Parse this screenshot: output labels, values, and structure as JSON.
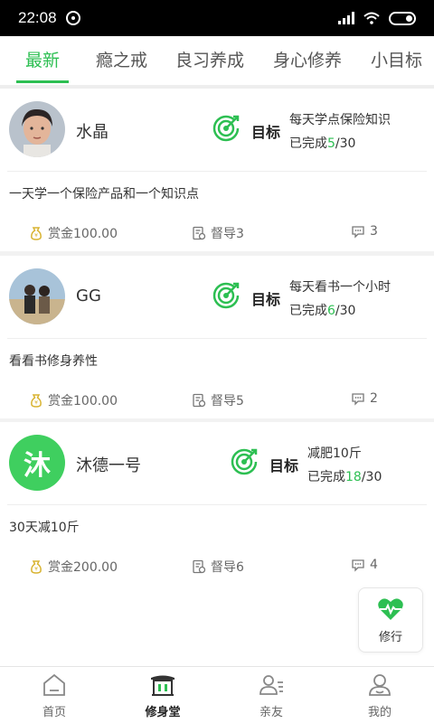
{
  "status_bar": {
    "time": "22:08"
  },
  "tabs": [
    {
      "label": "最新",
      "active": true
    },
    {
      "label": "瘾之戒",
      "active": false
    },
    {
      "label": "良习养成",
      "active": false
    },
    {
      "label": "身心修养",
      "active": false
    },
    {
      "label": "小目标",
      "active": false
    }
  ],
  "cards": [
    {
      "name": "水晶",
      "target_label": "目标",
      "goal_title": "每天学点保险知识",
      "progress_prefix": "已完成",
      "progress_done": "5",
      "progress_total": "/30",
      "description": "一天学一个保险产品和一个知识点",
      "reward": "赏金100.00",
      "supervisors": "督导3",
      "comments": "3"
    },
    {
      "name": "GG",
      "target_label": "目标",
      "goal_title": "每天看书一个小时",
      "progress_prefix": "已完成",
      "progress_done": "6",
      "progress_total": "/30",
      "description": "看看书修身养性",
      "reward": "赏金100.00",
      "supervisors": "督导5",
      "comments": "2"
    },
    {
      "name": "沐德一号",
      "avatar_text": "沐",
      "target_label": "目标",
      "goal_title": "减肥10斤",
      "progress_prefix": "已完成",
      "progress_done": "18",
      "progress_total": "/30",
      "description": "30天减10斤",
      "reward": "赏金200.00",
      "supervisors": "督导6",
      "comments": "4"
    }
  ],
  "float_button": {
    "label": "修行",
    "icon": "heart-pulse-icon"
  },
  "bottom_nav": [
    {
      "label": "首页",
      "icon": "home-icon",
      "active": false
    },
    {
      "label": "修身堂",
      "icon": "temple-icon",
      "active": true
    },
    {
      "label": "亲友",
      "icon": "friends-icon",
      "active": false
    },
    {
      "label": "我的",
      "icon": "profile-icon",
      "active": false
    }
  ],
  "colors": {
    "accent": "#2dbf52",
    "reward_gold": "#d8b330"
  }
}
